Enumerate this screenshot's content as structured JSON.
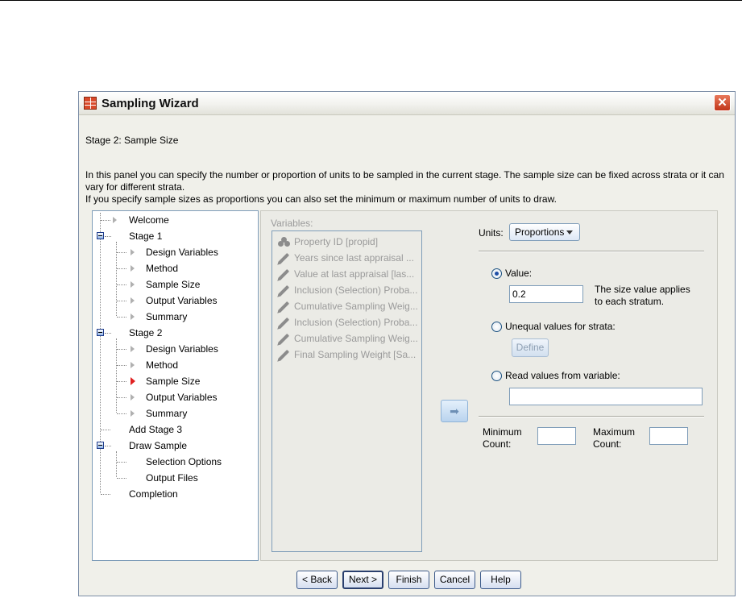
{
  "window": {
    "title": "Sampling Wizard",
    "close_glyph": "✕",
    "accent_color": "#d9492a"
  },
  "panel": {
    "stage_title": "Stage 2: Sample Size",
    "description_1": "In this panel you can specify the number or proportion of units to be sampled in the current stage. The sample size can be fixed across strata or it can vary for different strata.",
    "description_2": "If you specify sample sizes as proportions you can also set the minimum or maximum number of units to draw."
  },
  "tree": [
    {
      "label": "Welcome"
    },
    {
      "label": "Stage 1",
      "expanded": true
    },
    {
      "label": "Design Variables"
    },
    {
      "label": "Method"
    },
    {
      "label": "Sample Size"
    },
    {
      "label": "Output Variables"
    },
    {
      "label": "Summary"
    },
    {
      "label": "Stage 2",
      "expanded": true
    },
    {
      "label": "Design Variables"
    },
    {
      "label": "Method"
    },
    {
      "label": "Sample Size",
      "current": true
    },
    {
      "label": "Output Variables"
    },
    {
      "label": "Summary"
    },
    {
      "label": "Add Stage 3"
    },
    {
      "label": "Draw Sample",
      "expanded": true
    },
    {
      "label": "Selection Options"
    },
    {
      "label": "Output Files"
    },
    {
      "label": "Completion"
    }
  ],
  "variables": {
    "label": "Variables:",
    "items": [
      {
        "icon": "nominal-icon",
        "label": "Property ID [propid]"
      },
      {
        "icon": "scale-ruler-icon",
        "label": "Years since last appraisal ..."
      },
      {
        "icon": "scale-ruler-icon",
        "label": "Value at last appraisal [las..."
      },
      {
        "icon": "scale-ruler-icon",
        "label": "Inclusion (Selection) Proba..."
      },
      {
        "icon": "scale-ruler-icon",
        "label": "Cumulative Sampling Weig..."
      },
      {
        "icon": "scale-ruler-icon",
        "label": "Inclusion (Selection) Proba..."
      },
      {
        "icon": "scale-ruler-icon",
        "label": "Cumulative Sampling Weig..."
      },
      {
        "icon": "scale-ruler-icon",
        "label": "Final Sampling Weight [Sa..."
      }
    ]
  },
  "move_button": {
    "glyph": "➡"
  },
  "units": {
    "label": "Units:",
    "selected": "Proportions"
  },
  "options": {
    "value_label": "Value:",
    "value": "0.2",
    "value_selected": true,
    "hint_line1": "The size value applies",
    "hint_line2": "to each stratum.",
    "unequal_label": "Unequal values for strata:",
    "define_label": "Define",
    "read_label": "Read values from variable:",
    "read_value": ""
  },
  "counts": {
    "min_line1": "Minimum",
    "min_line2": "Count:",
    "max_line1": "Maximum",
    "max_line2": "Count:",
    "min_value": "",
    "max_value": ""
  },
  "footer": {
    "back": "< Back",
    "next": "Next >",
    "finish": "Finish",
    "cancel": "Cancel",
    "help": "Help"
  }
}
